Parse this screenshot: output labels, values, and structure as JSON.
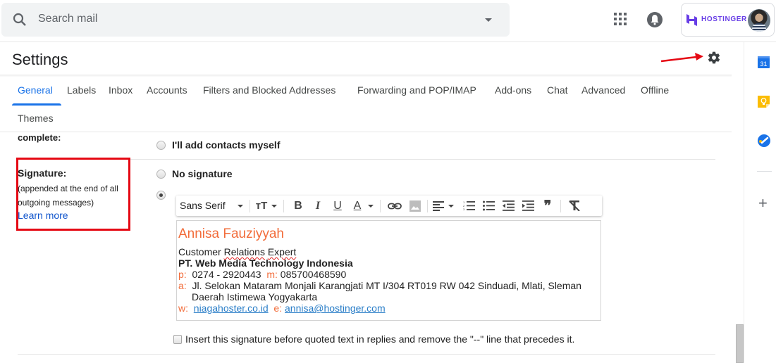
{
  "topbar": {
    "search_placeholder": "Search mail",
    "account_brand": "HOSTINGER"
  },
  "settings": {
    "title": "Settings",
    "tabs": [
      {
        "label": "General",
        "active": true
      },
      {
        "label": "Labels"
      },
      {
        "label": "Inbox"
      },
      {
        "label": "Accounts"
      },
      {
        "label": "Filters and Blocked Addresses"
      },
      {
        "label": "Forwarding and POP/IMAP"
      },
      {
        "label": "Add-ons"
      },
      {
        "label": "Chat"
      },
      {
        "label": "Advanced"
      },
      {
        "label": "Offline"
      },
      {
        "label": "Themes"
      }
    ]
  },
  "contacts_section": {
    "label": "complete:",
    "option": "I'll add contacts myself"
  },
  "signature_section": {
    "title": "Signature:",
    "subtitle": "(appended at the end of all outgoing messages)",
    "learn_more": "Learn more",
    "no_signature_label": "No signature",
    "selected": "custom",
    "toolbar": {
      "font": "Sans Serif",
      "buttons": [
        "font-size",
        "bold",
        "italic",
        "underline",
        "text-color",
        "link",
        "image",
        "align",
        "numbered-list",
        "bulleted-list",
        "indent-less",
        "indent-more",
        "quote",
        "remove-formatting"
      ]
    },
    "content": {
      "name": "Annisa Fauziyyah",
      "job_title_parts": [
        "Customer ",
        "Relations",
        " ",
        "Expert"
      ],
      "company": "PT. Web Media Technology Indonesia",
      "phone_label": "p:",
      "phone": "0274 - 2920443",
      "mobile_label": "m:",
      "mobile": "085700468590",
      "address_label": "a:",
      "address_line1": "Jl. Selokan Mataram Monjali Karangjati MT I/304 RT019 RW 042 Sinduadi, Mlati, Sleman",
      "address_line2": "Daerah Istimewa Yogyakarta",
      "web_label": "w:",
      "web": "niagahoster.co.id",
      "email_label": "e:",
      "email": "annisa@hostinger.com"
    },
    "insert_before_quoted_label": "Insert this signature before quoted text in replies and remove the \"--\" line that precedes it.",
    "insert_before_quoted_checked": false
  },
  "side_panel": {
    "calendar_day": "31",
    "items": [
      "calendar",
      "keep",
      "tasks",
      "add-ons"
    ]
  },
  "colors": {
    "accent": "#1a73e8",
    "signature_orange": "#f26c3a",
    "highlight_red": "#e50914",
    "hostinger_purple": "#673de6"
  }
}
